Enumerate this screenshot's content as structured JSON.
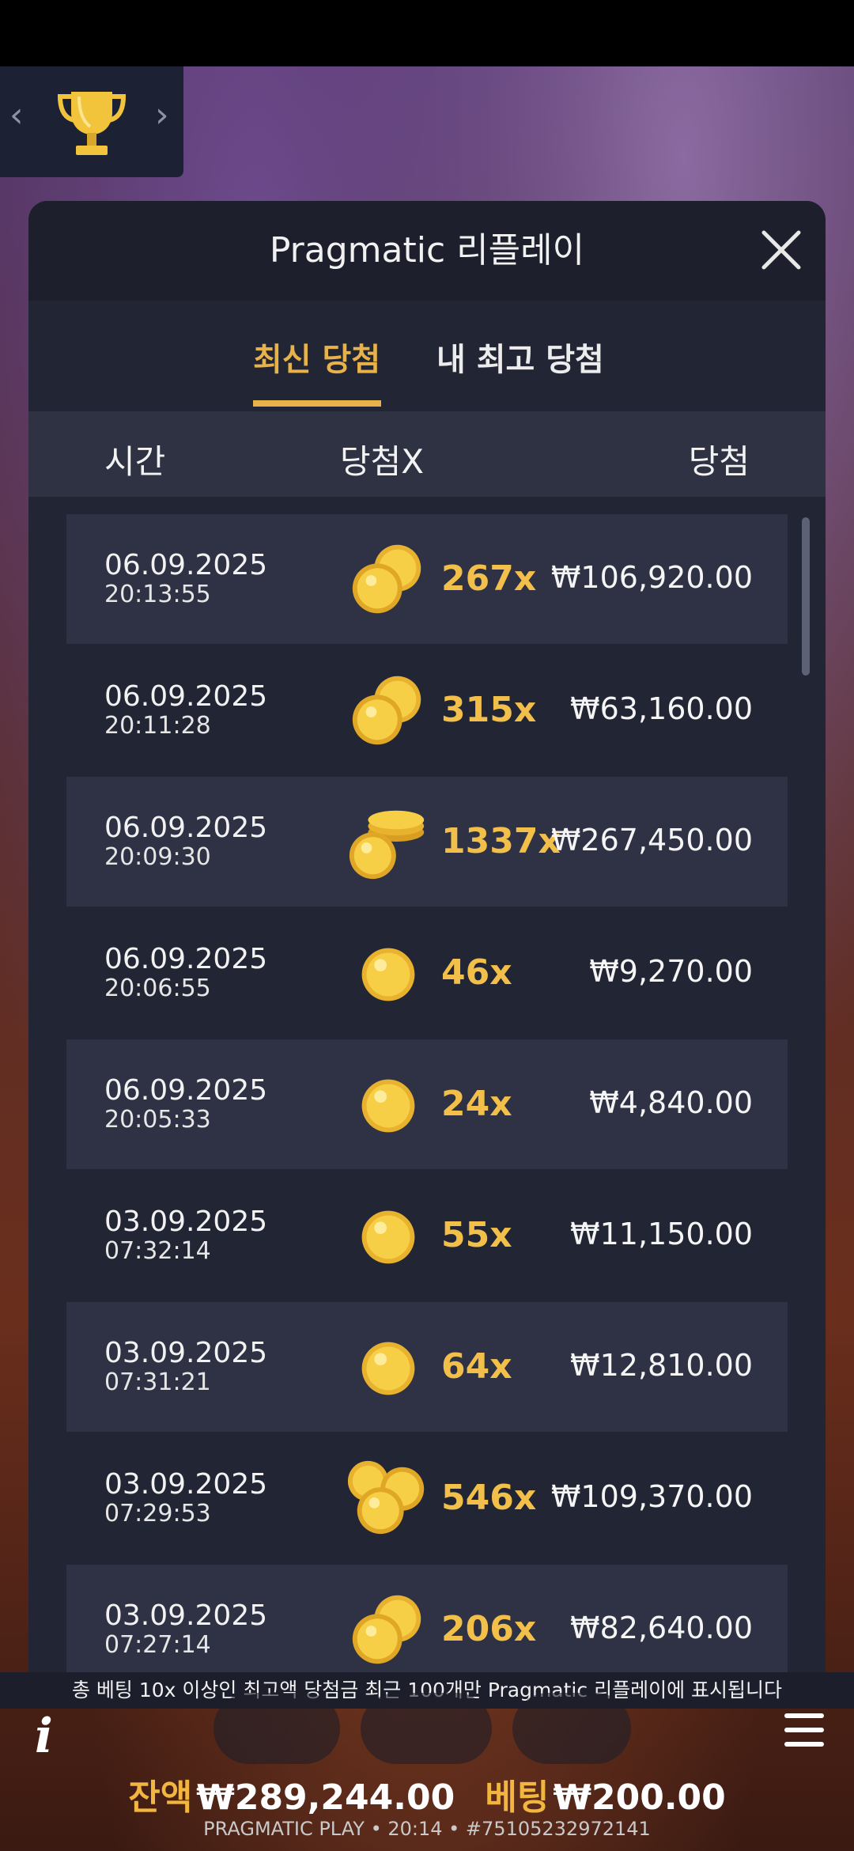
{
  "modal": {
    "title": "Pragmatic 리플레이",
    "tabs": [
      {
        "label": "최신 당첨",
        "active": true
      },
      {
        "label": "내 최고 당첨",
        "active": false
      }
    ],
    "columns": {
      "time": "시간",
      "multiplier": "당첨X",
      "win": "당첨"
    },
    "rows": [
      {
        "date": "06.09.2025",
        "time": "20:13:55",
        "icon": "coin-pair-icon",
        "multiplier": "267x",
        "win": "₩106,920.00"
      },
      {
        "date": "06.09.2025",
        "time": "20:11:28",
        "icon": "coin-pair-icon",
        "multiplier": "315x",
        "win": "₩63,160.00"
      },
      {
        "date": "06.09.2025",
        "time": "20:09:30",
        "icon": "coin-stack-icon",
        "multiplier": "1337x",
        "win": "₩267,450.00"
      },
      {
        "date": "06.09.2025",
        "time": "20:06:55",
        "icon": "coin-single-icon",
        "multiplier": "46x",
        "win": "₩9,270.00"
      },
      {
        "date": "06.09.2025",
        "time": "20:05:33",
        "icon": "coin-single-icon",
        "multiplier": "24x",
        "win": "₩4,840.00"
      },
      {
        "date": "03.09.2025",
        "time": "07:32:14",
        "icon": "coin-single-icon",
        "multiplier": "55x",
        "win": "₩11,150.00"
      },
      {
        "date": "03.09.2025",
        "time": "07:31:21",
        "icon": "coin-single-icon",
        "multiplier": "64x",
        "win": "₩12,810.00"
      },
      {
        "date": "03.09.2025",
        "time": "07:29:53",
        "icon": "coin-triple-icon",
        "multiplier": "546x",
        "win": "₩109,370.00"
      },
      {
        "date": "03.09.2025",
        "time": "07:27:14",
        "icon": "coin-pair-icon",
        "multiplier": "206x",
        "win": "₩82,640.00"
      }
    ]
  },
  "footer_note": "총 베팅 10x 이상인 최고액 당첨금 최근 100개만 Pragmatic 리플레이에 표시됩니다",
  "balance": {
    "label": "잔액",
    "value": "₩289,244.00"
  },
  "bet": {
    "label": "베팅",
    "value": "₩200.00"
  },
  "provider_line": "PRAGMATIC PLAY • 20:14 • #75105232972141",
  "colors": {
    "accent": "#e8b24a",
    "modal_bg": "#222534",
    "row_shade": "#2f3244"
  }
}
